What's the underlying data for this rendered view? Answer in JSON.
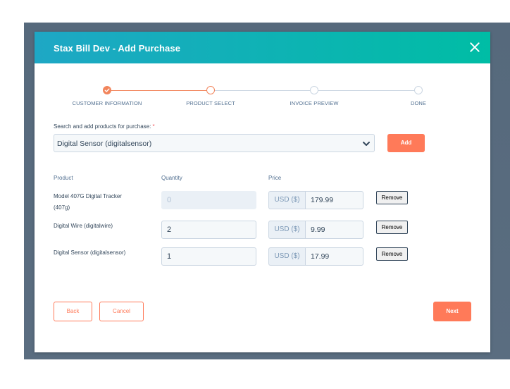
{
  "modal": {
    "title": "Stax Bill Dev - Add Purchase",
    "close_icon": "close-icon"
  },
  "stepper": {
    "steps": [
      {
        "label": "CUSTOMER INFORMATION",
        "state": "done"
      },
      {
        "label": "PRODUCT SELECT",
        "state": "current"
      },
      {
        "label": "INVOICE PREVIEW",
        "state": "todo"
      },
      {
        "label": "DONE",
        "state": "todo"
      }
    ]
  },
  "search": {
    "label": "Search and add products for purchase: ",
    "required_mark": "*",
    "selected_value": "Digital Sensor (digitalsensor)",
    "add_label": "Add"
  },
  "table": {
    "headers": {
      "product": "Product",
      "quantity": "Quantity",
      "price": "Price"
    },
    "rows": [
      {
        "product_line1": "Model 407G Digital Tracker",
        "product_line2": "(407g)",
        "quantity": "0",
        "currency": "USD ($)",
        "price": "179.99",
        "remove_label": "Remove"
      },
      {
        "product_line1": "Digital Wire (digitalwire)",
        "product_line2": "",
        "quantity": "2",
        "currency": "USD ($)",
        "price": "9.99",
        "remove_label": "Remove"
      },
      {
        "product_line1": "Digital Sensor (digitalsensor)",
        "product_line2": "",
        "quantity": "1",
        "currency": "USD ($)",
        "price": "17.99",
        "remove_label": "Remove"
      }
    ]
  },
  "footer": {
    "back_label": "Back",
    "cancel_label": "Cancel",
    "next_label": "Next"
  },
  "colors": {
    "accent": "#ff7a59",
    "header_start": "#1ea7c5",
    "header_end": "#00bda5"
  }
}
